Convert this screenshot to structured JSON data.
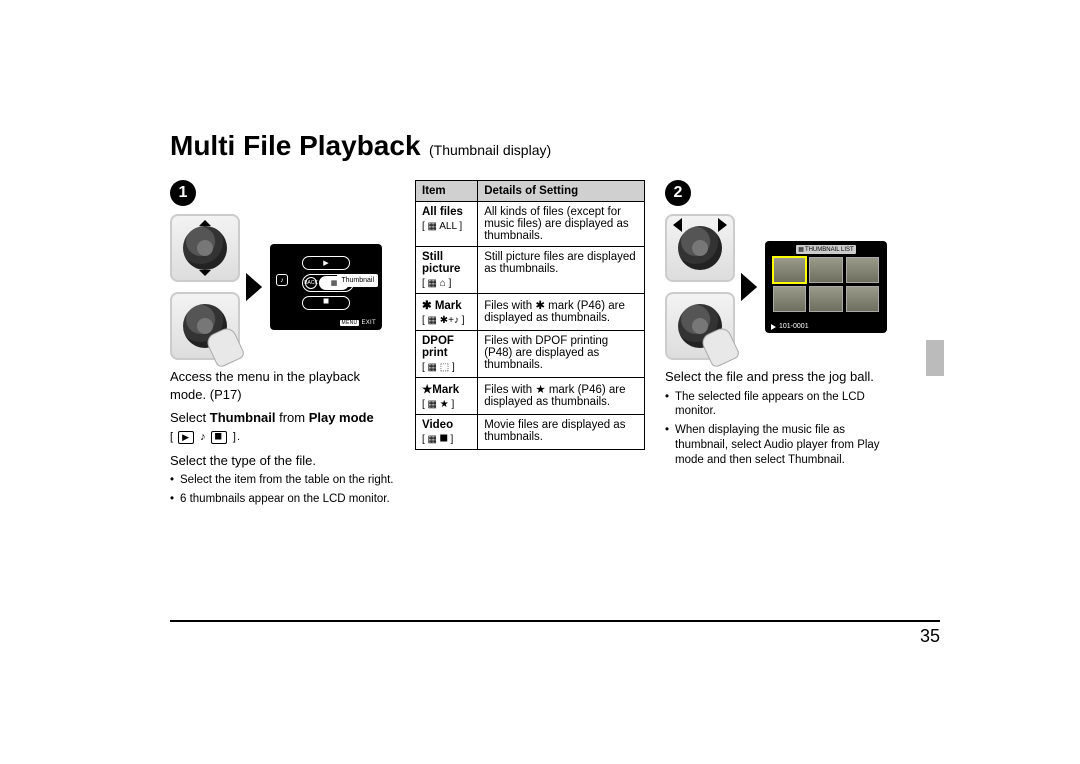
{
  "title": {
    "main": "Multi File Playback",
    "sub": "(Thumbnail display)"
  },
  "step1": {
    "badge": "1",
    "lcd": {
      "bubble": "Thumbnail",
      "back_label": "BACK",
      "menu_label": "MENU",
      "exit_label": "EXIT"
    },
    "line1": "Access the menu in the playback mode. (P17)",
    "line2_pre": "Select ",
    "line2_b1": "Thumbnail",
    "line2_mid": " from ",
    "line2_b2": "Play mode",
    "line3": "Select the type of the file.",
    "bullets": [
      "Select the item from the table on the right.",
      "6 thumbnails appear on the LCD monitor."
    ]
  },
  "table": {
    "head_item": "Item",
    "head_detail": "Details of Setting",
    "rows": [
      {
        "label": "All files",
        "icon": "[ ▦ ALL ]",
        "detail": "All kinds of files (except for music files) are displayed as thumbnails."
      },
      {
        "label": "Still picture",
        "icon": "[ ▦ ⌂ ]",
        "detail": "Still picture files are displayed as thumbnails."
      },
      {
        "label": "✱ Mark",
        "icon": "[ ▦ ✱+♪ ]",
        "detail_pre": "Files with ",
        "detail_mid": "✱",
        "detail_post": " mark (P46) are displayed as thumbnails."
      },
      {
        "label": "DPOF print",
        "icon": "[ ▦ ⬚ ]",
        "detail": "Files with DPOF printing (P48) are displayed as thumbnails."
      },
      {
        "label": "★Mark",
        "icon": "[ ▦ ★ ]",
        "detail_pre": "Files with ",
        "detail_mid": "★",
        "detail_post": " mark (P46) are displayed as thumbnails."
      },
      {
        "label": "Video",
        "icon": "[ ▦ ⯀ ]",
        "detail": "Movie files are displayed as thumbnails."
      }
    ]
  },
  "step2": {
    "badge": "2",
    "lcd": {
      "title": "THUMBNAIL LIST",
      "footer": "101-0001"
    },
    "line1": "Select the file and press the jog ball.",
    "bullets": [
      {
        "text": "The selected file appears on the LCD monitor."
      },
      {
        "pre": "When displaying the music file as thumbnail, select ",
        "b1": "Audio player",
        "mid": " from ",
        "b2": "Play mode",
        "mid2": " and then select ",
        "b3": "Thumbnail",
        "post": "."
      }
    ]
  },
  "page_number": "35"
}
